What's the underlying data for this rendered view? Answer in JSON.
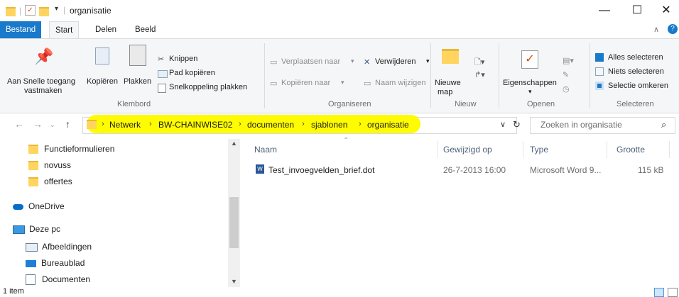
{
  "window": {
    "title": "organisatie",
    "minimize_glyph": "—",
    "maximize_glyph": "☐",
    "close_glyph": "✕"
  },
  "tabs": {
    "file": "Bestand",
    "home": "Start",
    "share": "Delen",
    "view": "Beeld"
  },
  "ribbon": {
    "pin_line1": "Aan Snelle toegang",
    "pin_line2": "vastmaken",
    "copy": "Kopiëren",
    "paste": "Plakken",
    "cut": "Knippen",
    "copy_path": "Pad kopiëren",
    "paste_shortcut": "Snelkoppeling plakken",
    "clipboard_group": "Klembord",
    "move_to": "Verplaatsen naar",
    "copy_to": "Kopiëren naar",
    "delete": "Verwijderen",
    "rename": "Naam wijzigen",
    "organize_group": "Organiseren",
    "new_folder_line1": "Nieuwe",
    "new_folder_line2": "map",
    "new_group": "Nieuw",
    "properties": "Eigenschappen",
    "open_group": "Openen",
    "select_all": "Alles selecteren",
    "select_none": "Niets selecteren",
    "invert_selection": "Selectie omkeren",
    "select_group": "Selecteren"
  },
  "address": {
    "crumbs": [
      "Netwerk",
      "BW-CHAINWISE02",
      "documenten",
      "sjablonen",
      "organisatie"
    ],
    "search_placeholder": "Zoeken in organisatie"
  },
  "nav": {
    "items": [
      {
        "label": "Functieformulieren",
        "icon": "folder-icon"
      },
      {
        "label": "novuss",
        "icon": "folder-icon"
      },
      {
        "label": "offertes",
        "icon": "folder-icon"
      },
      {
        "label": "OneDrive",
        "icon": "onedrive-icon"
      },
      {
        "label": "Deze pc",
        "icon": "computer-icon"
      },
      {
        "label": "Afbeeldingen",
        "icon": "pictures-icon"
      },
      {
        "label": "Bureaublad",
        "icon": "desktop-icon"
      },
      {
        "label": "Documenten",
        "icon": "documents-icon"
      }
    ]
  },
  "files": {
    "columns": [
      "Naam",
      "Gewijzigd op",
      "Type",
      "Grootte"
    ],
    "rows": [
      {
        "name": "Test_invoegvelden_brief.dot",
        "modified": "26-7-2013 16:00",
        "type": "Microsoft Word 9...",
        "size": "115 kB"
      }
    ]
  },
  "status": {
    "count": "1 item"
  },
  "colors": {
    "file_tab": "#1979ca",
    "highlight": "#fffb00",
    "folder": "#ffd45f"
  }
}
